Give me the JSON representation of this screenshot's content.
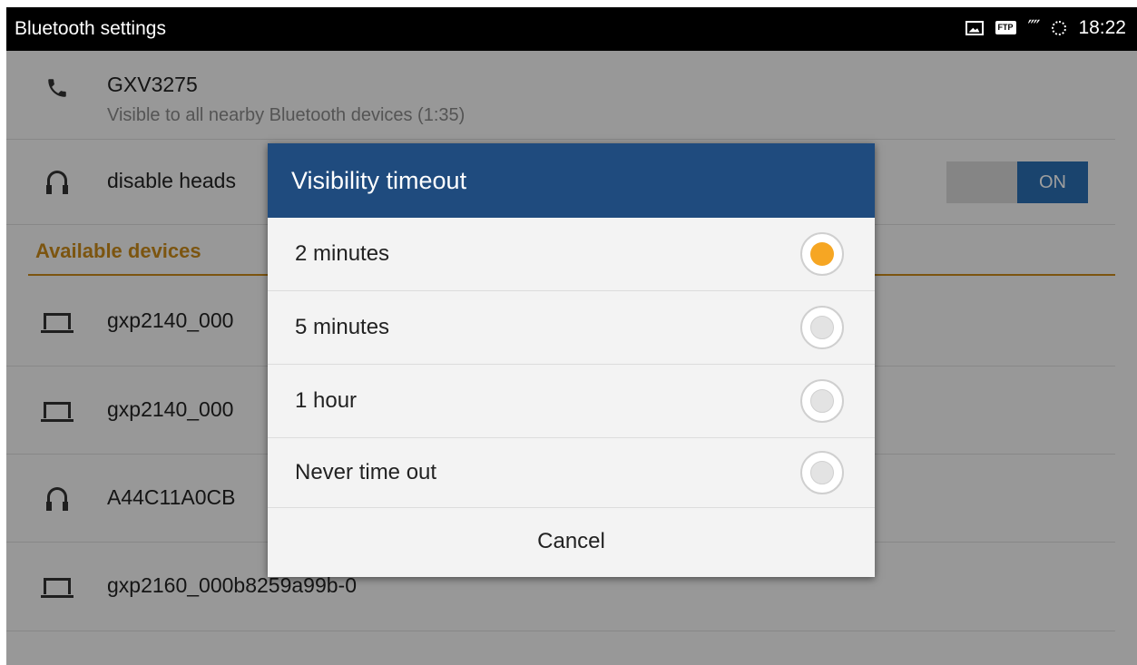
{
  "status_bar": {
    "title": "Bluetooth settings",
    "time": "18:22",
    "icons": [
      "image-icon",
      "ftp-icon",
      "bluetooth-icon",
      "sync-icon"
    ],
    "ftp_label": "FTP"
  },
  "device": {
    "name": "GXV3275",
    "subtitle": "Visible to all nearby Bluetooth devices (1:35)",
    "icon": "phone-icon"
  },
  "headset_row": {
    "label": "disable heads",
    "toggle": "ON",
    "icon": "headset-icon"
  },
  "section_title": "Available devices",
  "devices": [
    {
      "label": "gxp2140_000",
      "icon": "laptop-icon"
    },
    {
      "label": "gxp2140_000",
      "icon": "laptop-icon"
    },
    {
      "label": "A44C11A0CB",
      "icon": "headset-icon"
    },
    {
      "label": "gxp2160_000b8259a99b-0",
      "icon": "laptop-icon"
    }
  ],
  "dialog": {
    "title": "Visibility timeout",
    "options": [
      {
        "label": "2 minutes",
        "selected": true
      },
      {
        "label": "5 minutes",
        "selected": false
      },
      {
        "label": "1 hour",
        "selected": false
      },
      {
        "label": "Never time out",
        "selected": false
      }
    ],
    "cancel": "Cancel"
  },
  "colors": {
    "accent": "#c88a1a",
    "dialog_title_bg": "#1f4b7e",
    "radio_selected": "#f6a623",
    "toggle_on": "#2a6fb2"
  }
}
